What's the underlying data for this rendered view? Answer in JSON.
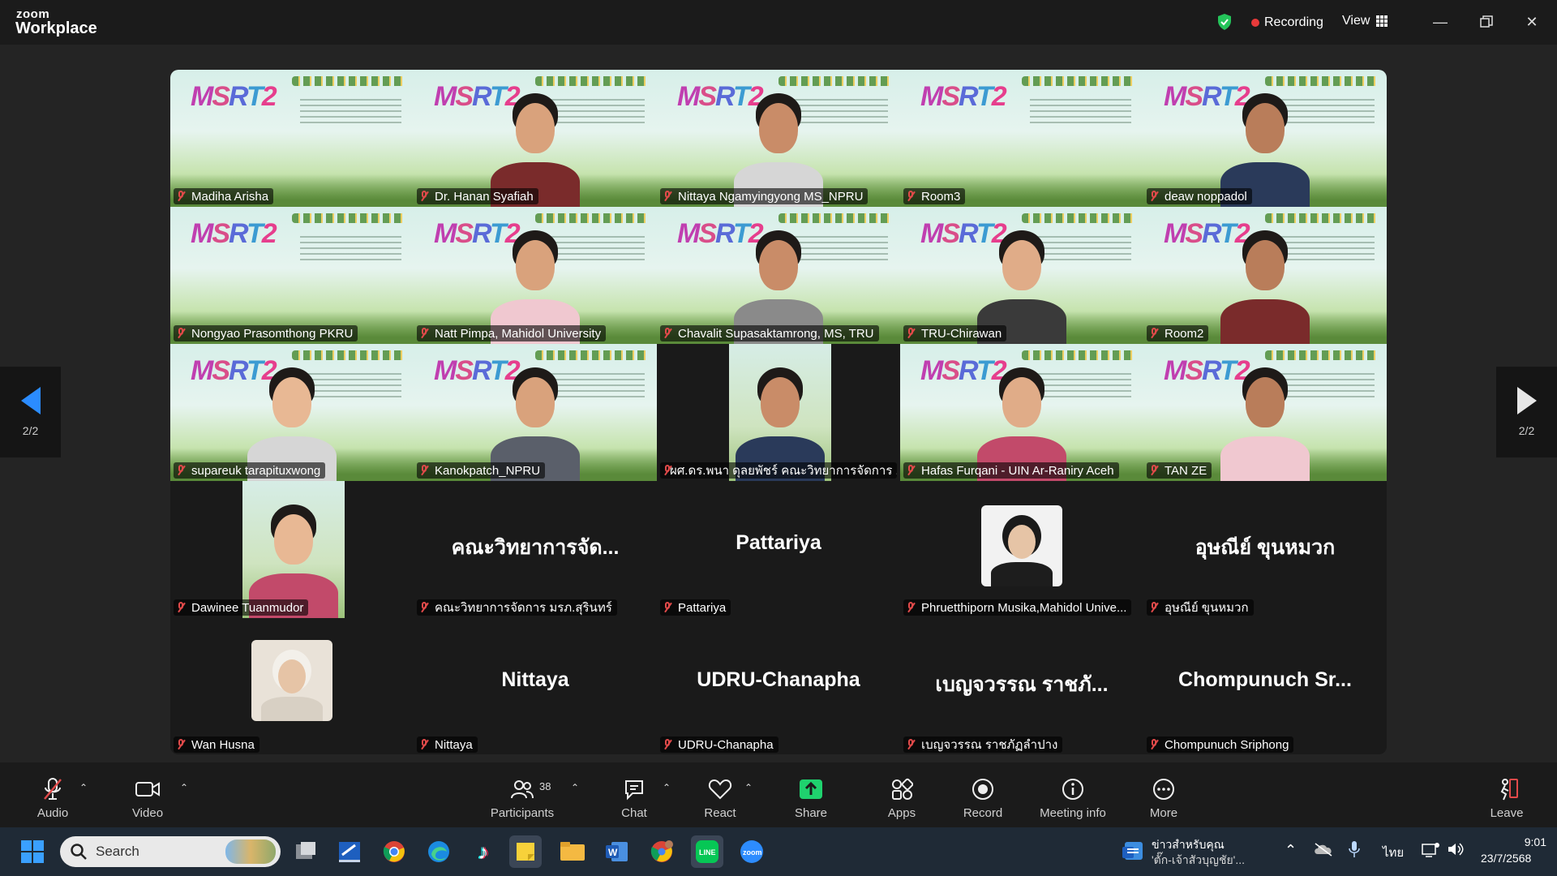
{
  "app": {
    "brand_top": "zoom",
    "brand_bottom": "Workplace"
  },
  "header": {
    "recording_label": "Recording",
    "view_label": "View"
  },
  "gallery": {
    "page_indicator": "2/2",
    "video_tiles": [
      {
        "name": "Madiha Arisha",
        "person": false
      },
      {
        "name": "Dr. Hanan Syafiah",
        "person": true
      },
      {
        "name": "Nittaya Ngamyingyong MS_NPRU",
        "person": true
      },
      {
        "name": "Room3",
        "person": false
      },
      {
        "name": "deaw noppadol",
        "person": true
      },
      {
        "name": "Nongyao Prasomthong PKRU",
        "person": false
      },
      {
        "name": "Natt Pimpa, Mahidol University",
        "person": true
      },
      {
        "name": "Chavalit Supasaktamrong, MS, TRU",
        "person": true
      },
      {
        "name": "TRU-Chirawan",
        "person": true
      },
      {
        "name": "Room2",
        "person": true
      },
      {
        "name": "supareuk tarapituxwong",
        "person": true
      },
      {
        "name": "Kanokpatch_NPRU",
        "person": true
      },
      {
        "name": "ผศ.ดร.พนา ดุลยพัชร์ คณะวิทยาการจัดการ ...",
        "person": true,
        "inset": true
      },
      {
        "name": "Hafas Furqani - UIN Ar-Raniry Aceh",
        "person": true
      },
      {
        "name": "TAN ZE",
        "person": true
      }
    ],
    "row4": [
      {
        "name": "Dawinee Tuanmudor",
        "big": ""
      },
      {
        "name": "คณะวิทยาการจัดการ มรภ.สุรินทร์",
        "big": "คณะวิทยาการจัด..."
      },
      {
        "name": "Pattariya",
        "big": "Pattariya"
      },
      {
        "name": "Phruetthiporn Musika,Mahidol Unive...",
        "big": ""
      },
      {
        "name": "อุษณีย์ ขุนหมวก",
        "big": "อุษณีย์ ขุนหมวก"
      }
    ],
    "row5": [
      {
        "name": "Wan Husna",
        "big": ""
      },
      {
        "name": "Nittaya",
        "big": "Nittaya"
      },
      {
        "name": "UDRU-Chanapha",
        "big": "UDRU-Chanapha"
      },
      {
        "name": "เบญจวรรณ ราชภัฏลำปาง",
        "big": "เบญจวรรณ ราชภั..."
      },
      {
        "name": "Chompunuch Sriphong",
        "big": "Chompunuch Sr..."
      }
    ]
  },
  "toolbar": {
    "audio": "Audio",
    "video": "Video",
    "participants": "Participants",
    "participants_count": "38",
    "chat": "Chat",
    "react": "React",
    "share": "Share",
    "apps": "Apps",
    "record": "Record",
    "meeting_info": "Meeting info",
    "more": "More",
    "leave": "Leave"
  },
  "taskbar": {
    "search_placeholder": "Search",
    "news_line1": "ข่าวสำหรับคุณ",
    "news_line2": "'ตั๊ก-เจ้าสัวบุญชัย'...",
    "lang": "ไทย",
    "time": "9:01",
    "date": "23/7/2568"
  },
  "colors": {
    "accent_blue": "#2b8cff",
    "share_green": "#1fd26e",
    "mute_red": "#e14a4a",
    "shield_green": "#24c45a"
  }
}
